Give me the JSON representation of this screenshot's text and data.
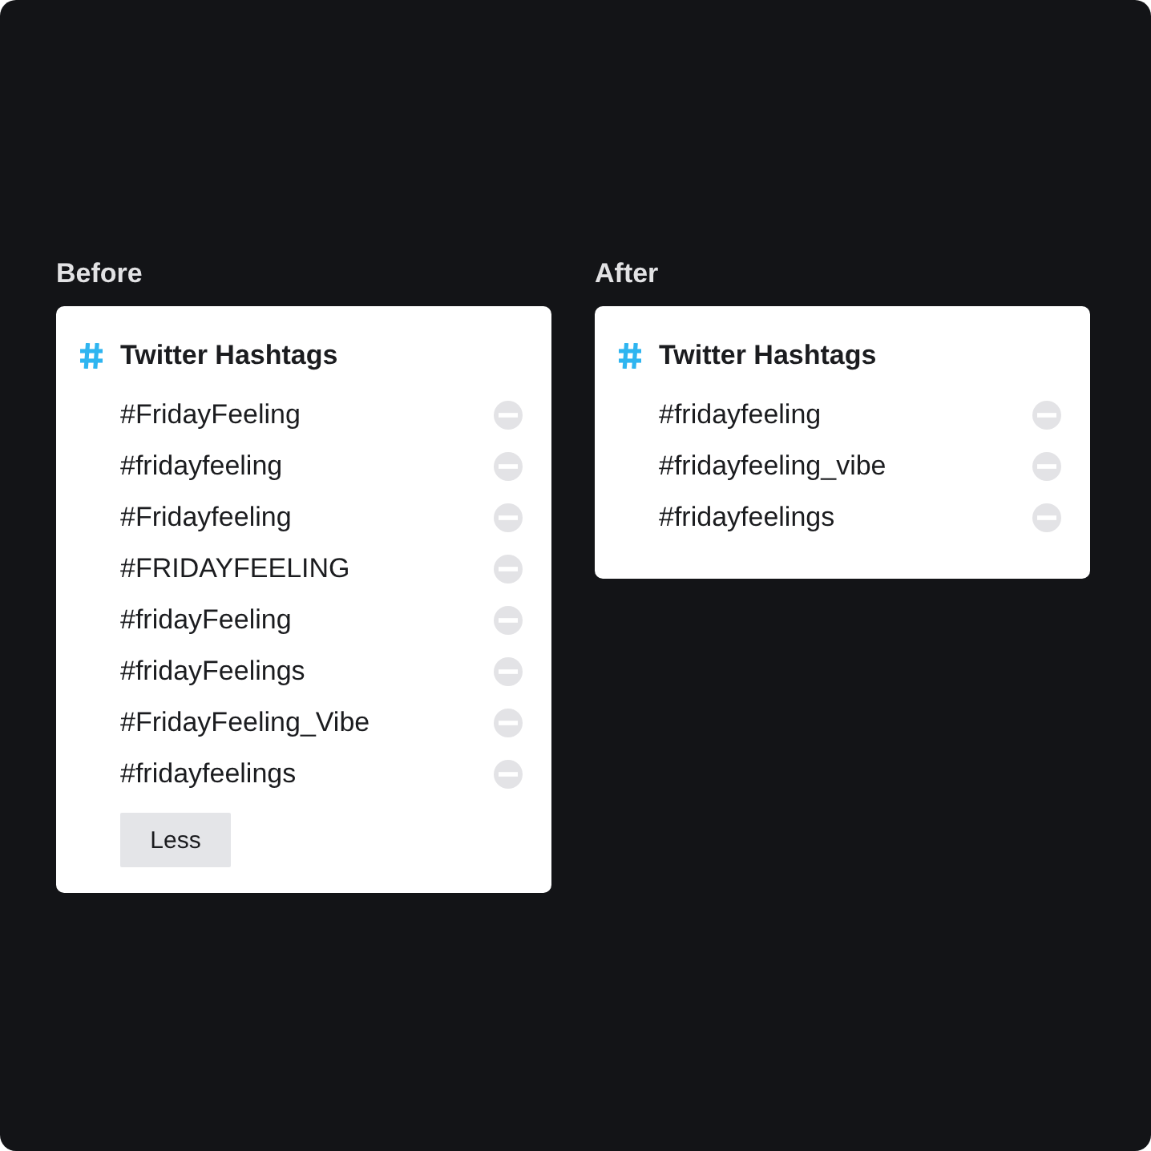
{
  "panels": [
    {
      "label": "Before",
      "card": {
        "title": "Twitter Hashtags",
        "hashtags": [
          "#FridayFeeling",
          "#fridayfeeling",
          "#Fridayfeeling",
          "#FRIDAYFEELING",
          "#fridayFeeling",
          "#fridayFeelings",
          "#FridayFeeling_Vibe",
          "#fridayfeelings"
        ],
        "button": "Less"
      }
    },
    {
      "label": "After",
      "card": {
        "title": "Twitter Hashtags",
        "hashtags": [
          "#fridayfeeling",
          "#fridayfeeling_vibe",
          "#fridayfeelings"
        ]
      }
    }
  ]
}
